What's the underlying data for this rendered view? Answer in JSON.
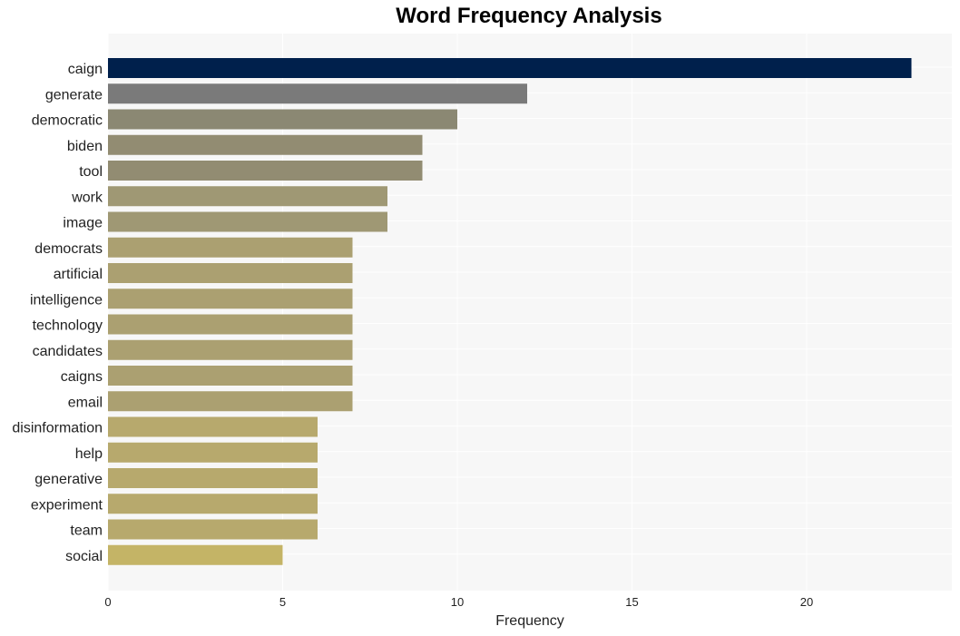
{
  "chart_data": {
    "type": "bar",
    "orientation": "horizontal",
    "title": "Word Frequency Analysis",
    "xlabel": "Frequency",
    "ylabel": "",
    "xlim": [
      0,
      24.2
    ],
    "xticks": [
      0,
      5,
      10,
      15,
      20
    ],
    "grid": true,
    "categories": [
      "caign",
      "generate",
      "democratic",
      "biden",
      "tool",
      "work",
      "image",
      "democrats",
      "artificial",
      "intelligence",
      "technology",
      "candidates",
      "caigns",
      "email",
      "disinformation",
      "help",
      "generative",
      "experiment",
      "team",
      "social"
    ],
    "values": [
      23,
      12,
      10,
      9,
      9,
      8,
      8,
      7,
      7,
      7,
      7,
      7,
      7,
      7,
      6,
      6,
      6,
      6,
      6,
      5
    ],
    "colors": [
      "#00204c",
      "#7a7a7a",
      "#8b8873",
      "#928c72",
      "#928c72",
      "#9f9874",
      "#9f9874",
      "#aba071",
      "#aba071",
      "#aba071",
      "#aba071",
      "#aba071",
      "#aba071",
      "#aba071",
      "#b7a96d",
      "#b7a96d",
      "#b7a96d",
      "#b7a96d",
      "#b7a96d",
      "#c4b466"
    ],
    "plot_background": "#f7f7f7"
  }
}
